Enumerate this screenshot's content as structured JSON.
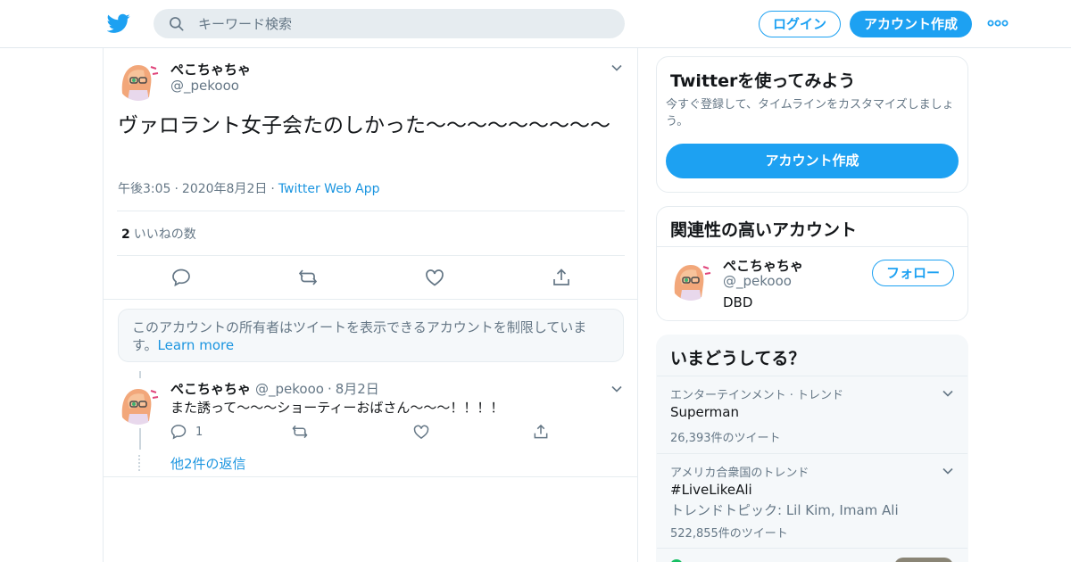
{
  "header": {
    "search_placeholder": "キーワード検索",
    "login_label": "ログイン",
    "signup_label": "アカウント作成"
  },
  "tweet": {
    "name": "ぺこちゃちゃ",
    "handle": "@_pekooo",
    "text": "ヴァロラント女子会たのしかった～～～～～～～～～",
    "time": "午後3:05",
    "date": "2020年8月2日",
    "source": "Twitter Web App",
    "like_count": "2",
    "like_label": "いいねの数"
  },
  "notice": {
    "text": "このアカウントの所有者はツイートを表示できるアカウントを制限しています。",
    "link": "Learn more"
  },
  "reply": {
    "name": "ぺこちゃちゃ",
    "handle": "@_pekooo",
    "date": "8月2日",
    "text": "また誘って〜〜〜ショーティーおばさん〜〜〜！！！！",
    "reply_count": "1",
    "more_replies": "他2件の返信"
  },
  "signup_card": {
    "title": "Twitterを使ってみよう",
    "subtitle": "今すぐ登録して、タイムラインをカスタマイズしましょう。",
    "button": "アカウント作成"
  },
  "related_card": {
    "title": "関連性の高いアカウント",
    "name": "ぺこちゃちゃ",
    "handle": "@_pekooo",
    "bio": "DBD",
    "follow": "フォロー"
  },
  "trends_card": {
    "title": "いまどうしてる？",
    "items": [
      {
        "context": "エンターテインメント · トレンド",
        "name": "Superman",
        "description": "",
        "count": "26,393件のツイート"
      },
      {
        "context": "アメリカ合衆国のトレンド",
        "name": "#LiveLikeAli",
        "description": "トレンドトピック: Lil Kim, Imam Ali",
        "count": "522,855件のツイート"
      }
    ]
  },
  "colors": {
    "accent": "#1da1f2",
    "link": "#1b95e0",
    "text": "#14171a",
    "secondary": "#657786",
    "border": "#e6ecf0"
  }
}
